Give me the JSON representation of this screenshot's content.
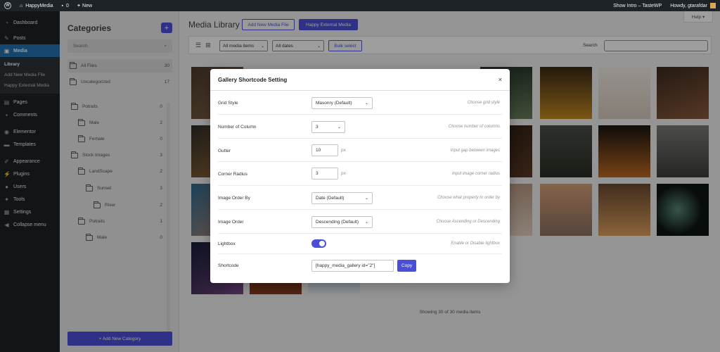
{
  "adminbar": {
    "site_name": "HappyMedia",
    "comments_count": "0",
    "new_label": "New",
    "show_intro": "Show Intro – TasteWP",
    "howdy": "Howdy, gtarafdar"
  },
  "sidebar": {
    "dashboard": "Dashboard",
    "posts": "Posts",
    "media": "Media",
    "submenu": [
      "Library",
      "Add New Media File",
      "Happy External Media"
    ],
    "pages": "Pages",
    "comments": "Comments",
    "elementor": "Elementor",
    "templates": "Templates",
    "appearance": "Appearance",
    "plugins": "Plugins",
    "users": "Users",
    "tools": "Tools",
    "settings": "Settings",
    "collapse": "Collapse menu"
  },
  "categories": {
    "title": "Categories",
    "add_icon": "+",
    "search_placeholder": "Search",
    "items": [
      {
        "label": "All Files",
        "count": "30"
      },
      {
        "label": "Uncategorized",
        "count": "17"
      },
      {
        "label": "Potraits",
        "count": "0"
      },
      {
        "label": "Male",
        "count": "2"
      },
      {
        "label": "Female",
        "count": "0"
      },
      {
        "label": "Stock Images",
        "count": "3"
      },
      {
        "label": "LandScape",
        "count": "2"
      },
      {
        "label": "Sunset",
        "count": "3"
      },
      {
        "label": "River",
        "count": "2"
      },
      {
        "label": "Potraits",
        "count": "1"
      },
      {
        "label": "Male",
        "count": "0"
      }
    ],
    "new_category": "+ Add New Category"
  },
  "main": {
    "title": "Media Library",
    "add_new": "Add New Media File",
    "external": "Happy External Media",
    "help": "Help ▾",
    "filter_type": "All media items",
    "filter_date": "All dates",
    "bulk_select": "Bulk select",
    "search_label": "Search",
    "showing": "Showing 30 of 30 media items"
  },
  "modal": {
    "title": "Gallery Shortcode Setting",
    "close": "×",
    "rows": {
      "grid_style": {
        "label": "Grid Style",
        "value": "Masonry (Default)",
        "hint": "Choose grid style"
      },
      "columns": {
        "label": "Number of Column",
        "value": "3",
        "hint": "Choose number of columns"
      },
      "gutter": {
        "label": "Gutter",
        "value": "10",
        "unit": "px",
        "hint": "Input gap between images"
      },
      "radius": {
        "label": "Corner Radius",
        "value": "3",
        "unit": "px",
        "hint": "Input image corner radius"
      },
      "order_by": {
        "label": "Image Order By",
        "value": "Date (Default)",
        "hint": "Choose what property to order by"
      },
      "order": {
        "label": "Image Order",
        "value": "Descending (Default)",
        "hint": "Choose Ascending or Descending"
      },
      "lightbox": {
        "label": "Lightbox",
        "enabled": true,
        "hint": "Enable or Disable lightbox"
      },
      "shortcode": {
        "label": "Shortcode",
        "value": "[happy_media_gallery id=\"2\"]",
        "copy": "Copy"
      }
    }
  },
  "colors": {
    "accent": "#4b4fd8",
    "admin_dark": "#1d2327",
    "active_menu": "#2271b1"
  }
}
